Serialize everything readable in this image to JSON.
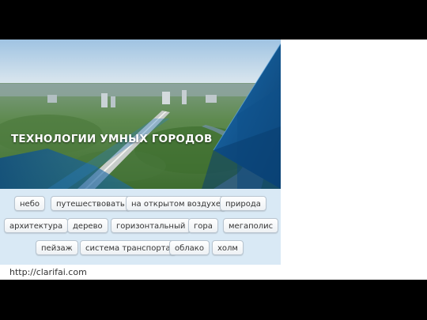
{
  "hero": {
    "title": "ТЕХНОЛОГИИ УМНЫХ ГОРОДОВ"
  },
  "tags": {
    "row1": [
      "небо",
      "путешествовать",
      "на открытом воздухе",
      "природа"
    ],
    "row2": [
      "архитектура",
      "дерево",
      "горизонтальный",
      "гора",
      "мегаполис"
    ],
    "row3": [
      "пейзаж",
      "система транспорта",
      "облако",
      "холм"
    ]
  },
  "caption": "http://clarifai.com"
}
